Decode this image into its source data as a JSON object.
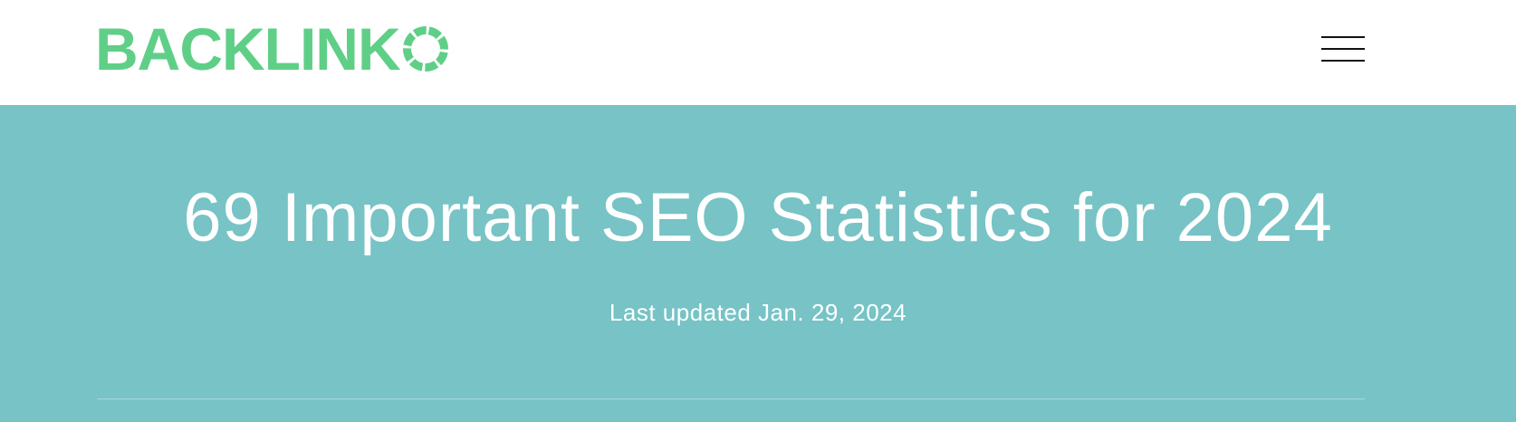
{
  "header": {
    "logo_text": "BACKLINK",
    "logo_color": "#5fcf87",
    "menu_icon": "hamburger-menu-icon"
  },
  "hero": {
    "background_color": "#77c3c6",
    "title": "69 Important SEO Statistics for 2024",
    "updated": "Last updated Jan. 29, 2024"
  }
}
